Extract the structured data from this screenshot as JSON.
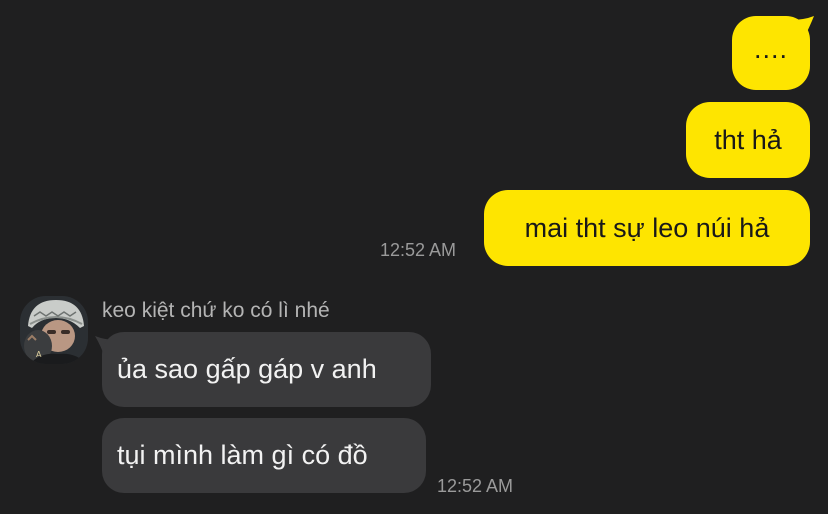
{
  "colors": {
    "background": "#1f1f20",
    "sent_bubble": "#fee500",
    "received_bubble": "#3a3a3c",
    "timestamp": "#9a9a9a"
  },
  "sent_messages": [
    {
      "text": "...."
    },
    {
      "text": "tht hả"
    },
    {
      "text": "mai tht sự leo núi hả"
    }
  ],
  "sent_timestamp": "12:52 AM",
  "received": {
    "sender_name": "keo kiệt chứ ko có lì nhé",
    "avatar_icon": "user-avatar-photo",
    "messages": [
      {
        "text": "ủa sao gấp gáp v anh"
      },
      {
        "text": "tụi mình làm gì có đồ"
      }
    ],
    "timestamp": "12:52 AM"
  }
}
